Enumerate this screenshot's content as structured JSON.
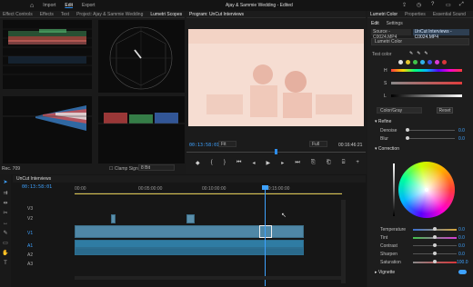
{
  "topbar": {
    "modes": [
      "Import",
      "Edit",
      "Export"
    ],
    "active_mode": "Edit",
    "title": "Ajay & Sammie Wedding - Edited"
  },
  "left_panel": {
    "tabs": [
      "Effect Controls",
      "Effects",
      "Text",
      "Project: Ajay & Sammie Wedding",
      "Lumetri Scopes"
    ],
    "active_tab": "Lumetri Scopes",
    "bottom_left": "Rec. 709",
    "clamp_label": "Clamp Signal",
    "bit_depth": "8 Bit"
  },
  "program": {
    "title": "Program: UnCut Interviews",
    "timecode": "00:13:58:01",
    "fit": "Fit",
    "quality": "Full",
    "duration": "00:16:46:21"
  },
  "timeline": {
    "title": "UnCut Interviews",
    "timecode": "00:13:58:01",
    "ruler": [
      "00:00",
      "00:05:00:00",
      "00:10:00:00",
      "00:15:00:00"
    ],
    "tracks_video": [
      "V3",
      "V2",
      "V1"
    ],
    "tracks_audio": [
      "A1",
      "A2",
      "A3"
    ]
  },
  "lumetri": {
    "tabs": [
      "Lumetri Color",
      "Properties",
      "Essential Sound"
    ],
    "subtabs": [
      "Edit",
      "Settings"
    ],
    "source": "Source - C0024.MP4",
    "clip": "UnCut Interviews - C0024.MP4",
    "effect": "Lumetri Color",
    "sections": {
      "refine": "Refine",
      "correction": "Correction",
      "vignette": "Vignette"
    },
    "refine_labels": [
      "Denoise",
      "Blur"
    ],
    "refine_values": [
      "0.0",
      "0.0"
    ],
    "mode": "Color/Gray",
    "reset": "Reset",
    "sliders": [
      {
        "label": "Temperature",
        "value": "0.0"
      },
      {
        "label": "Tint",
        "value": "0.0"
      },
      {
        "label": "Contrast",
        "value": "0.0"
      },
      {
        "label": "Sharpen",
        "value": "0.0"
      },
      {
        "label": "Saturation",
        "value": "100.0"
      }
    ],
    "test_color": "Test color",
    "hsl_labels": [
      "H",
      "S",
      "L"
    ]
  }
}
